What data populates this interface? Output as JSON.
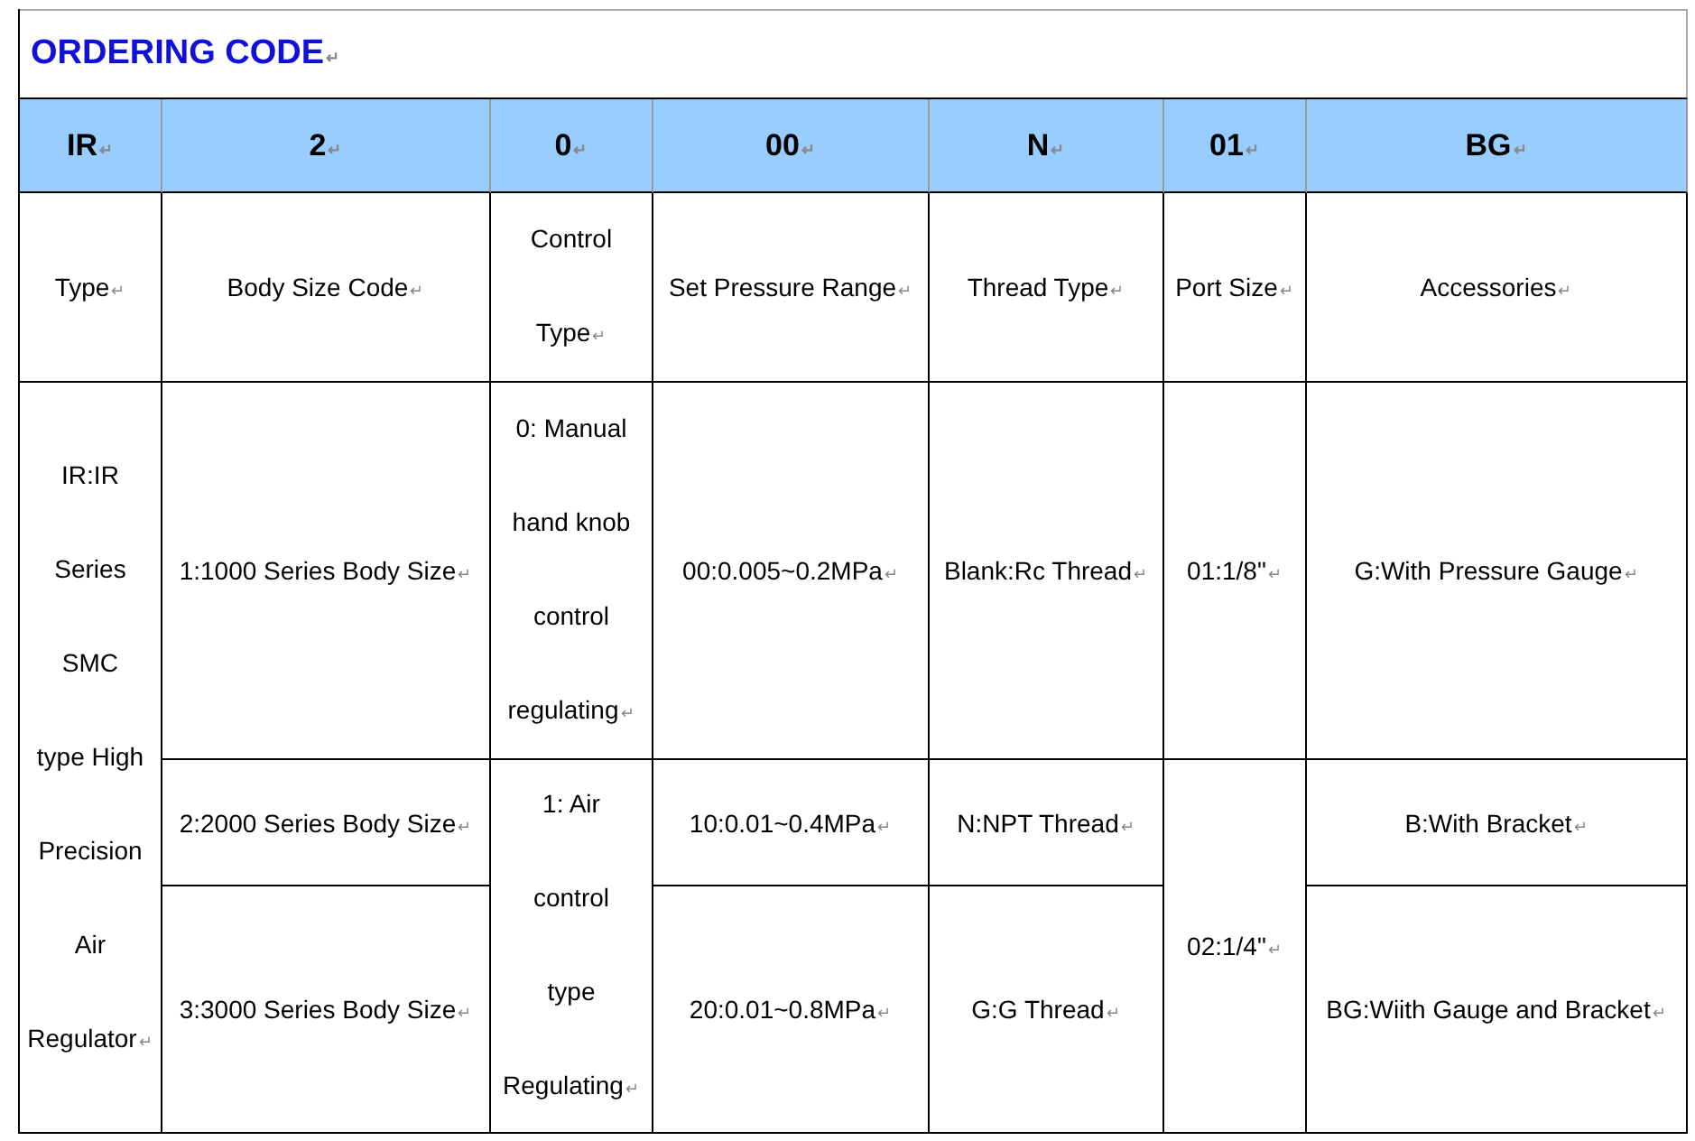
{
  "title": "ORDERING CODE",
  "paragraph_mark": "↵",
  "table": {
    "codes": [
      "IR",
      "2",
      "0",
      "00",
      "N",
      "01",
      "BG"
    ],
    "labels": [
      "Type",
      "Body Size Code",
      "Control\nType",
      "Set Pressure Range",
      "Thread Type",
      "Port Size",
      "Accessories"
    ],
    "rows": [
      [
        {
          "text": "IR:IR\nSeries\nSMC\ntype High\nPrecision\nAir\nRegulator",
          "rowspan": 3
        },
        {
          "text": "1:1000 Series Body Size"
        },
        {
          "text": "0: Manual\nhand knob\ncontrol\nregulating"
        },
        {
          "text": "00:0.005~0.2MPa"
        },
        {
          "text": "Blank:Rc Thread"
        },
        {
          "text": "01:1/8\""
        },
        {
          "text": "G:With Pressure Gauge"
        }
      ],
      [
        {
          "text": "2:2000 Series Body Size"
        },
        {
          "text": "1: Air\ncontrol\ntype\nRegulating",
          "rowspan": 2
        },
        {
          "text": "10:0.01~0.4MPa"
        },
        {
          "text": "N:NPT Thread"
        },
        {
          "text": "02:1/4\"",
          "rowspan": 2
        },
        {
          "text": "B:With Bracket"
        }
      ],
      [
        {
          "text": "3:3000 Series Body Size"
        },
        {
          "text": "20:0.01~0.8MPa"
        },
        {
          "text": "G:G Thread"
        },
        {
          "text": "BG:Wiith Gauge and Bracket"
        }
      ]
    ]
  }
}
